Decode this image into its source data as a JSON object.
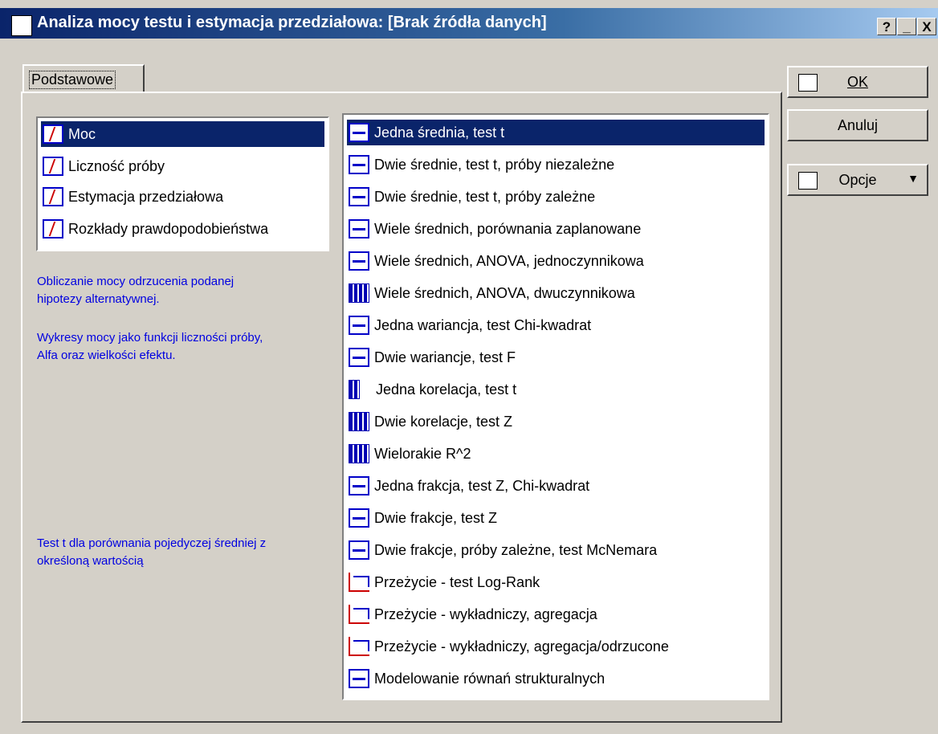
{
  "window": {
    "title": "Analiza mocy testu i estymacja przedziałowa: [Brak źródła danych]",
    "caption_buttons": [
      "?",
      "_",
      "X"
    ]
  },
  "tab": {
    "label": "Podstawowe"
  },
  "left_list": {
    "items": [
      {
        "label": "Moc",
        "icon": "power-icon",
        "selected": true
      },
      {
        "label": "Liczność próby",
        "icon": "sample-size-icon",
        "selected": false
      },
      {
        "label": "Estymacja przedziałowa",
        "icon": "interval-estimation-icon",
        "selected": false
      },
      {
        "label": "Rozkłady prawdopodobieństwa",
        "icon": "probability-distribution-icon",
        "selected": false
      }
    ]
  },
  "descriptions": {
    "power_line1": "Obliczanie mocy odrzucenia podanej",
    "power_line2": "hipotezy alternatywnej.",
    "plots_line1": "Wykresy mocy jako funkcji liczności próby,",
    "plots_line2": "Alfa oraz wielkości efektu.",
    "test_line1": "Test t dla porównania pojedyczej średniej z",
    "test_line2": "określoną wartością"
  },
  "right_list": {
    "items": [
      {
        "label": "Jedna średnia, test t",
        "icon": "one-mean-icon",
        "selected": true
      },
      {
        "label": "Dwie średnie, test t, próby niezależne",
        "icon": "two-means-independent-icon",
        "selected": false
      },
      {
        "label": "Dwie średnie, test t, próby zależne",
        "icon": "two-means-dependent-icon",
        "selected": false
      },
      {
        "label": "Wiele średnich, porównania zaplanowane",
        "icon": "planned-comparisons-icon",
        "selected": false
      },
      {
        "label": "Wiele średnich, ANOVA, jednoczynnikowa",
        "icon": "one-way-anova-icon",
        "selected": false
      },
      {
        "label": "Wiele średnich, ANOVA, dwuczynnikowa",
        "icon": "two-way-anova-icon",
        "selected": false
      },
      {
        "label": "Jedna wariancja, test Chi-kwadrat",
        "icon": "one-variance-icon",
        "selected": false
      },
      {
        "label": "Dwie wariancje, test F",
        "icon": "two-variances-icon",
        "selected": false
      },
      {
        "label": "Jedna korelacja, test t",
        "icon": "one-correlation-icon",
        "selected": false
      },
      {
        "label": "Dwie korelacje, test Z",
        "icon": "two-correlations-icon",
        "selected": false
      },
      {
        "label": "Wielorakie R^2",
        "icon": "multiple-r2-icon",
        "selected": false
      },
      {
        "label": "Jedna frakcja, test Z, Chi-kwadrat",
        "icon": "one-proportion-icon",
        "selected": false
      },
      {
        "label": "Dwie frakcje, test Z",
        "icon": "two-proportions-icon",
        "selected": false
      },
      {
        "label": "Dwie frakcje, próby zależne, test McNemara",
        "icon": "mcnemar-icon",
        "selected": false
      },
      {
        "label": "Przeżycie - test Log-Rank",
        "icon": "survival-logrank-icon",
        "selected": false
      },
      {
        "label": "Przeżycie - wykładniczy, agregacja",
        "icon": "survival-exponential-icon",
        "selected": false
      },
      {
        "label": "Przeżycie - wykładniczy, agregacja/odrzucone",
        "icon": "survival-exponential-censored-icon",
        "selected": false
      },
      {
        "label": "Modelowanie równań strukturalnych",
        "icon": "sem-icon",
        "selected": false
      }
    ]
  },
  "buttons": {
    "ok": "OK",
    "cancel": "Anuluj",
    "options": "Opcje"
  },
  "colors": {
    "title_bar": "#0a246a",
    "selection": "#0a246a",
    "description_text": "#0000e0",
    "face": "#d4d0c8"
  }
}
